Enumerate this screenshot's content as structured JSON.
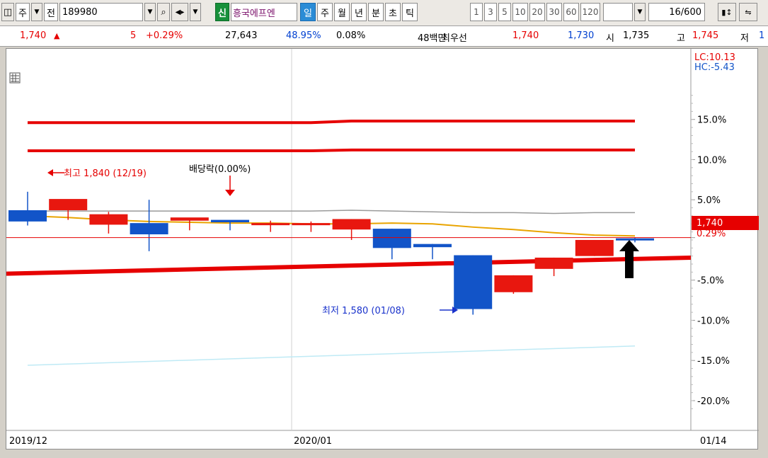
{
  "toolbar": {
    "type_label": "주",
    "prev_label": "전",
    "code": "189980",
    "badge": "신",
    "name": "흥국에프엔",
    "periods": [
      "일",
      "주",
      "월",
      "년",
      "분",
      "초",
      "틱"
    ],
    "selected_period": "일",
    "intervals": [
      "1",
      "3",
      "5",
      "10",
      "20",
      "30",
      "60",
      "120"
    ],
    "count": "16",
    "count_total": "/600"
  },
  "quote": {
    "price": "1,740",
    "change": "5",
    "change_pct": "+0.29%",
    "volume": "27,643",
    "volume_ratio": "48.95%",
    "turnover": "0.08%",
    "amount": "48백만",
    "best_label": "최우선",
    "ask": "1,740",
    "bid": "1,730",
    "open_label": "시",
    "open": "1,735",
    "high_label": "고",
    "high": "1,745",
    "low_label": "저",
    "low": "1"
  },
  "colors": {
    "up": "#e8170f",
    "down": "#1254c8",
    "ma": "#e9a400",
    "trend": "#e60000",
    "price_badge": "#e60000"
  },
  "chart_data": {
    "type": "candlestick",
    "y_axis_unit": "%",
    "y_ticks": [
      "15.0%",
      "10.0%",
      "5.0%",
      "0.29%",
      "-5.0%",
      "-10.0%",
      "-15.0%",
      "-20.0%"
    ],
    "y_range": [
      -21.5,
      18.5
    ],
    "lc_label": "LC:10.13",
    "hc_label": "HC:-5.43",
    "x_labels": [
      "2019/12",
      "2020/01"
    ],
    "current_date": "01/14",
    "candles": [
      {
        "open": 3.7,
        "high": 6.0,
        "low": 1.8,
        "close": 2.3
      },
      {
        "open": 3.7,
        "high": 5.0,
        "low": 2.5,
        "close": 5.1
      },
      {
        "open": 1.9,
        "high": 3.5,
        "low": 0.8,
        "close": 3.2
      },
      {
        "open": 2.1,
        "high": 5.0,
        "low": -1.4,
        "close": 0.7
      },
      {
        "open": 2.4,
        "high": 2.6,
        "low": 1.2,
        "close": 2.8
      },
      {
        "open": 2.5,
        "high": 2.4,
        "low": 1.2,
        "close": 2.2
      },
      {
        "open": 2.1,
        "high": 2.4,
        "low": 1.0,
        "close": 2.1
      },
      {
        "open": 2.1,
        "high": 2.3,
        "low": 1.0,
        "close": 2.1
      },
      {
        "open": 1.3,
        "high": 2.6,
        "low": 0.0,
        "close": 2.6
      },
      {
        "open": 1.4,
        "high": 1.4,
        "low": -2.4,
        "close": -1.0
      },
      {
        "open": -0.5,
        "high": -0.5,
        "low": -2.4,
        "close": -0.9
      },
      {
        "open": -1.9,
        "high": -1.9,
        "low": -9.3,
        "close": -8.6
      },
      {
        "open": -6.5,
        "high": -4.4,
        "low": -6.7,
        "close": -4.4
      },
      {
        "open": -3.6,
        "high": -2.2,
        "low": -4.5,
        "close": -2.2
      },
      {
        "open": -2.0,
        "high": 0.0,
        "low": -2.0,
        "close": 0.0
      },
      {
        "open": 0.2,
        "high": 0.3,
        "low": -0.3,
        "close": 0.0
      }
    ],
    "ma_line": [
      3.0,
      2.8,
      2.5,
      2.3,
      2.2,
      2.1,
      2.1,
      2.0,
      2.0,
      2.1,
      2.0,
      1.6,
      1.3,
      0.9,
      0.6,
      0.5
    ],
    "gray_line": [
      3.6,
      3.6,
      3.6,
      3.6,
      3.6,
      3.6,
      3.6,
      3.6,
      3.7,
      3.6,
      3.5,
      3.4,
      3.4,
      3.3,
      3.4,
      3.4
    ],
    "upper_band_1": [
      14.6,
      14.6,
      14.6,
      14.6,
      14.6,
      14.6,
      14.6,
      14.6,
      14.8,
      14.8,
      14.8,
      14.8,
      14.8,
      14.8,
      14.8,
      14.8
    ],
    "upper_band_2": [
      11.1,
      11.1,
      11.1,
      11.1,
      11.1,
      11.1,
      11.1,
      11.1,
      11.2,
      11.2,
      11.2,
      11.2,
      11.2,
      11.2,
      11.2,
      11.2
    ],
    "trend_line": {
      "start": -4.2,
      "end": -2.2
    },
    "lower_light": {
      "start": -15.6,
      "end": -13.2
    },
    "current_price_label": "1,740",
    "current_pct_label": "0.29%",
    "high_annotation": "최고 1,840 (12/19)",
    "low_annotation": "최저 1,580 (01/08)",
    "dividend_annotation": "배당락(0.00%)"
  }
}
